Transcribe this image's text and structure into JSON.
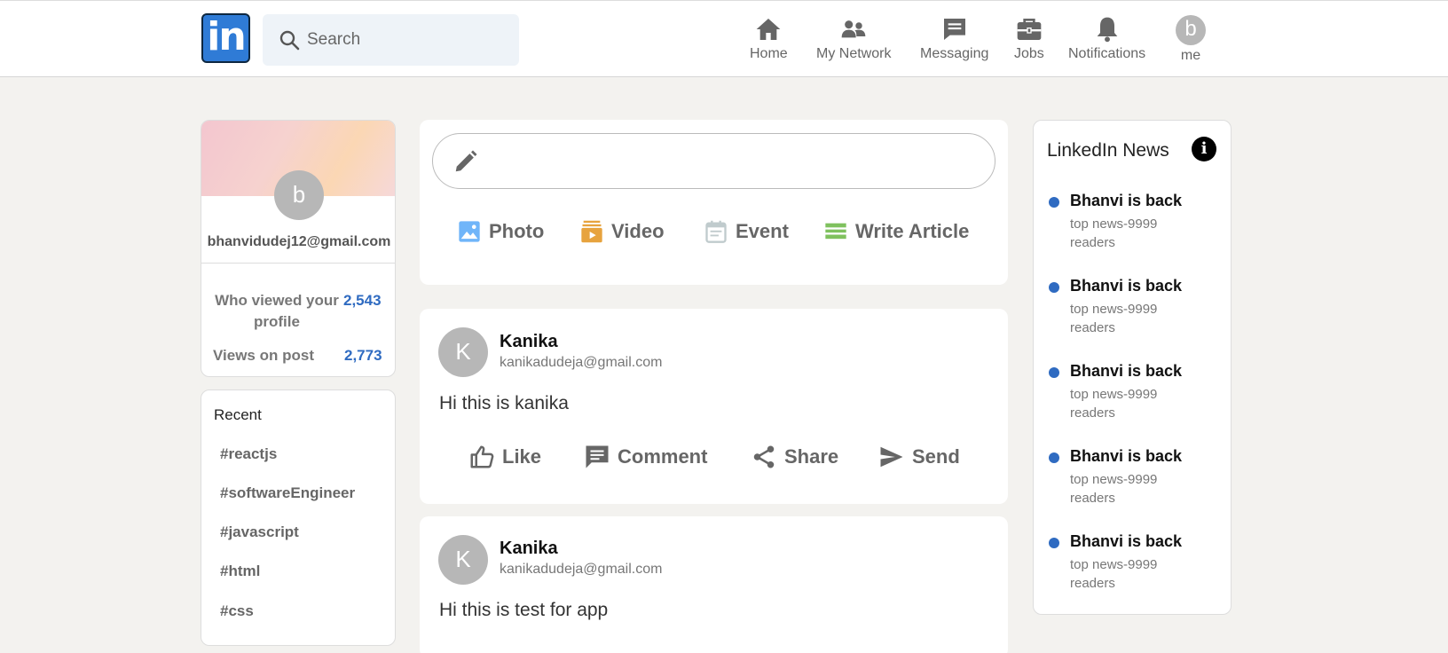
{
  "header": {
    "logo_text": "in",
    "search_placeholder": "Search",
    "nav": [
      {
        "label": "Home",
        "icon": "home-icon"
      },
      {
        "label": "My Network",
        "icon": "network-icon"
      },
      {
        "label": "Messaging",
        "icon": "messaging-icon"
      },
      {
        "label": "Jobs",
        "icon": "briefcase-icon"
      },
      {
        "label": "Notifications",
        "icon": "bell-icon"
      },
      {
        "label": "me",
        "avatar_letter": "b"
      }
    ]
  },
  "profile": {
    "avatar_letter": "b",
    "email": "bhanvidudej12@gmail.com",
    "stats": [
      {
        "label": "Who viewed your profile",
        "value": "2,543"
      },
      {
        "label": "Views on post",
        "value": "2,773"
      }
    ]
  },
  "recent": {
    "title": "Recent",
    "tags": [
      "#reactjs",
      "#softwareEngineer",
      "#javascript",
      "#html",
      "#css"
    ]
  },
  "share_box": {
    "actions": [
      {
        "label": "Photo",
        "icon": "photo-icon",
        "color": "#70b5f9"
      },
      {
        "label": "Video",
        "icon": "video-icon",
        "color": "#e7a33e"
      },
      {
        "label": "Event",
        "icon": "event-icon",
        "color": "#c0cbcd"
      },
      {
        "label": "Write Article",
        "icon": "article-icon",
        "color": "#7fc15e"
      }
    ]
  },
  "posts": [
    {
      "avatar_letter": "K",
      "name": "Kanika",
      "email": "kanikadudeja@gmail.com",
      "text": "Hi this is kanika",
      "actions": [
        "Like",
        "Comment",
        "Share",
        "Send"
      ]
    },
    {
      "avatar_letter": "K",
      "name": "Kanika",
      "email": "kanikadudeja@gmail.com",
      "text": "Hi this is test for app"
    }
  ],
  "news": {
    "title": "LinkedIn News",
    "info_icon": "i",
    "items": [
      {
        "headline": "Bhanvi is back",
        "sub": "top news-9999 readers"
      },
      {
        "headline": "Bhanvi is back",
        "sub": "top news-9999 readers"
      },
      {
        "headline": "Bhanvi is back",
        "sub": "top news-9999 readers"
      },
      {
        "headline": "Bhanvi is back",
        "sub": "top news-9999 readers"
      },
      {
        "headline": "Bhanvi is back",
        "sub": "top news-9999 readers"
      }
    ]
  },
  "colors": {
    "brand": "#2f7bd6",
    "accent_blue": "#2f6bc1",
    "background": "#f3f2ef"
  }
}
